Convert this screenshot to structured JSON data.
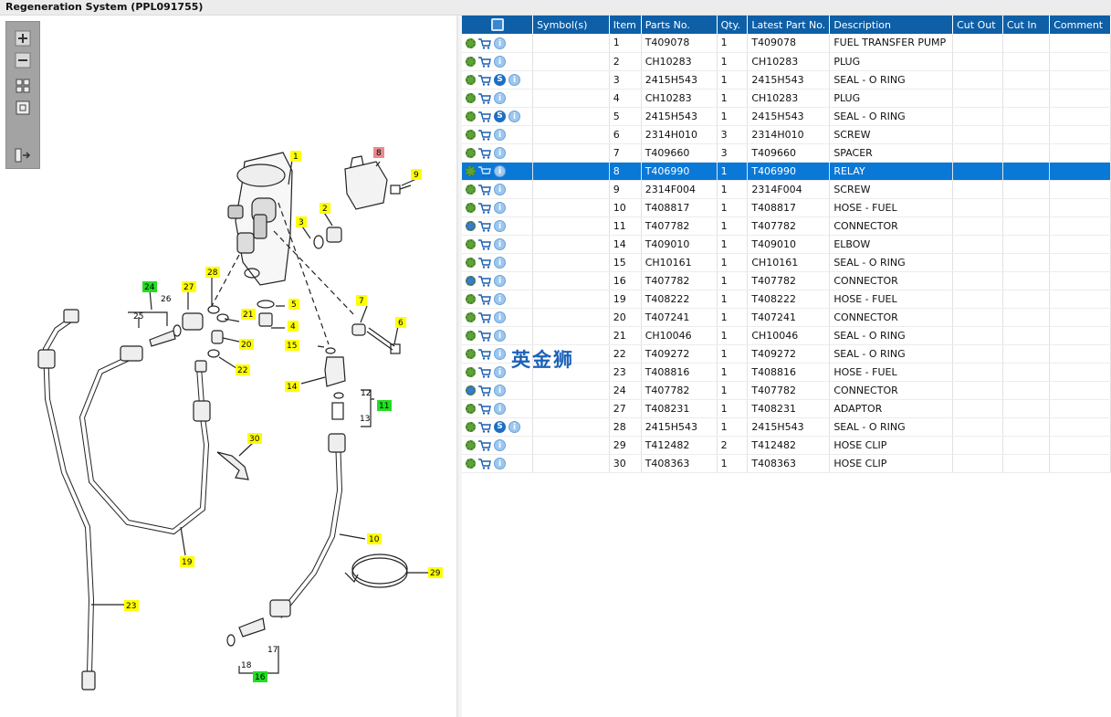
{
  "window": {
    "title": "Regeneration System (PPL091755)"
  },
  "toolbar": {
    "buttons": [
      "zoom-in",
      "zoom-out",
      "fit-all",
      "actual-size",
      "show-list"
    ]
  },
  "colors": {
    "header_blue": "#0e5fa6",
    "selected_row": "#0a78d7",
    "callout_yellow": "#ffff00",
    "callout_green": "#22dd22",
    "callout_red": "#e88a8a"
  },
  "diagram": {
    "callouts": [
      {
        "label": "1",
        "color": "yellow"
      },
      {
        "label": "2",
        "color": "yellow"
      },
      {
        "label": "3",
        "color": "yellow"
      },
      {
        "label": "4",
        "color": "yellow"
      },
      {
        "label": "5",
        "color": "yellow"
      },
      {
        "label": "6",
        "color": "yellow"
      },
      {
        "label": "7",
        "color": "yellow"
      },
      {
        "label": "8",
        "color": "red"
      },
      {
        "label": "9",
        "color": "yellow"
      },
      {
        "label": "10",
        "color": "yellow"
      },
      {
        "label": "11",
        "color": "green"
      },
      {
        "label": "14",
        "color": "yellow"
      },
      {
        "label": "15",
        "color": "yellow"
      },
      {
        "label": "16",
        "color": "green"
      },
      {
        "label": "19",
        "color": "yellow"
      },
      {
        "label": "20",
        "color": "yellow"
      },
      {
        "label": "21",
        "color": "yellow"
      },
      {
        "label": "22",
        "color": "yellow"
      },
      {
        "label": "23",
        "color": "yellow"
      },
      {
        "label": "24",
        "color": "green"
      },
      {
        "label": "27",
        "color": "yellow"
      },
      {
        "label": "28",
        "color": "yellow"
      },
      {
        "label": "29",
        "color": "yellow"
      },
      {
        "label": "30",
        "color": "yellow"
      }
    ],
    "plain_labels": [
      "12",
      "13",
      "17",
      "18",
      "25",
      "26"
    ]
  },
  "table": {
    "columns": [
      "",
      "Symbol(s)",
      "Item",
      "Parts No.",
      "Qty.",
      "Latest Part No.",
      "Description",
      "Cut Out",
      "Cut In",
      "Comment"
    ],
    "rows": [
      {
        "icons": [
          "gear",
          "cart",
          "info"
        ],
        "item": "1",
        "part": "T409078",
        "qty": "1",
        "latest": "T409078",
        "desc": "FUEL TRANSFER PUMP"
      },
      {
        "icons": [
          "gear",
          "cart",
          "info"
        ],
        "item": "2",
        "part": "CH10283",
        "qty": "1",
        "latest": "CH10283",
        "desc": "PLUG"
      },
      {
        "icons": [
          "gear",
          "cart",
          "s",
          "info"
        ],
        "item": "3",
        "part": "2415H543",
        "qty": "1",
        "latest": "2415H543",
        "desc": "SEAL - O RING"
      },
      {
        "icons": [
          "gear",
          "cart",
          "info"
        ],
        "item": "4",
        "part": "CH10283",
        "qty": "1",
        "latest": "CH10283",
        "desc": "PLUG"
      },
      {
        "icons": [
          "gear",
          "cart",
          "s",
          "info"
        ],
        "item": "5",
        "part": "2415H543",
        "qty": "1",
        "latest": "2415H543",
        "desc": "SEAL - O RING"
      },
      {
        "icons": [
          "gear",
          "cart",
          "info"
        ],
        "item": "6",
        "part": "2314H010",
        "qty": "3",
        "latest": "2314H010",
        "desc": "SCREW"
      },
      {
        "icons": [
          "gear",
          "cart",
          "info"
        ],
        "item": "7",
        "part": "T409660",
        "qty": "3",
        "latest": "T409660",
        "desc": "SPACER"
      },
      {
        "icons": [
          "gear",
          "cart",
          "info"
        ],
        "item": "8",
        "part": "T406990",
        "qty": "1",
        "latest": "T406990",
        "desc": "RELAY",
        "selected": true
      },
      {
        "icons": [
          "gear",
          "cart",
          "info"
        ],
        "item": "9",
        "part": "2314F004",
        "qty": "1",
        "latest": "2314F004",
        "desc": "SCREW"
      },
      {
        "icons": [
          "gear",
          "cart",
          "info"
        ],
        "item": "10",
        "part": "T408817",
        "qty": "1",
        "latest": "T408817",
        "desc": "HOSE - FUEL"
      },
      {
        "icons": [
          "gears",
          "cart",
          "info"
        ],
        "item": "11",
        "part": "T407782",
        "qty": "1",
        "latest": "T407782",
        "desc": "CONNECTOR"
      },
      {
        "icons": [
          "gear",
          "cart",
          "info"
        ],
        "item": "14",
        "part": "T409010",
        "qty": "1",
        "latest": "T409010",
        "desc": "ELBOW"
      },
      {
        "icons": [
          "gear",
          "cart",
          "info"
        ],
        "item": "15",
        "part": "CH10161",
        "qty": "1",
        "latest": "CH10161",
        "desc": "SEAL - O RING"
      },
      {
        "icons": [
          "gears",
          "cart",
          "info"
        ],
        "item": "16",
        "part": "T407782",
        "qty": "1",
        "latest": "T407782",
        "desc": "CONNECTOR"
      },
      {
        "icons": [
          "gear",
          "cart",
          "info"
        ],
        "item": "19",
        "part": "T408222",
        "qty": "1",
        "latest": "T408222",
        "desc": "HOSE - FUEL"
      },
      {
        "icons": [
          "gear",
          "cart",
          "info"
        ],
        "item": "20",
        "part": "T407241",
        "qty": "1",
        "latest": "T407241",
        "desc": "CONNECTOR"
      },
      {
        "icons": [
          "gear",
          "cart",
          "info"
        ],
        "item": "21",
        "part": "CH10046",
        "qty": "1",
        "latest": "CH10046",
        "desc": "SEAL - O RING"
      },
      {
        "icons": [
          "gear",
          "cart",
          "info"
        ],
        "item": "22",
        "part": "T409272",
        "qty": "1",
        "latest": "T409272",
        "desc": "SEAL - O RING"
      },
      {
        "icons": [
          "gear",
          "cart",
          "info"
        ],
        "item": "23",
        "part": "T408816",
        "qty": "1",
        "latest": "T408816",
        "desc": "HOSE - FUEL"
      },
      {
        "icons": [
          "gears",
          "cart",
          "info"
        ],
        "item": "24",
        "part": "T407782",
        "qty": "1",
        "latest": "T407782",
        "desc": "CONNECTOR"
      },
      {
        "icons": [
          "gear",
          "cart",
          "info"
        ],
        "item": "27",
        "part": "T408231",
        "qty": "1",
        "latest": "T408231",
        "desc": "ADAPTOR"
      },
      {
        "icons": [
          "gear",
          "cart",
          "s",
          "info"
        ],
        "item": "28",
        "part": "2415H543",
        "qty": "1",
        "latest": "2415H543",
        "desc": "SEAL - O RING"
      },
      {
        "icons": [
          "gear",
          "cart",
          "info"
        ],
        "item": "29",
        "part": "T412482",
        "qty": "2",
        "latest": "T412482",
        "desc": "HOSE CLIP"
      },
      {
        "icons": [
          "gear",
          "cart",
          "info"
        ],
        "item": "30",
        "part": "T408363",
        "qty": "1",
        "latest": "T408363",
        "desc": "HOSE CLIP"
      }
    ]
  },
  "watermark": "英金狮"
}
